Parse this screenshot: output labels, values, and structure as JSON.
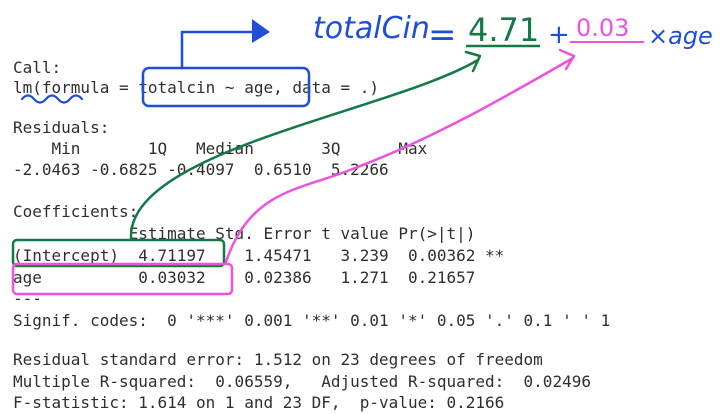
{
  "output": {
    "call_header": "Call:",
    "call_line": "lm(formula = totalcin ~ age, data = .)",
    "residuals_header": "Residuals:",
    "residuals_labels": "    Min       1Q   Median       3Q      Max ",
    "residuals_values": "-2.0463 -0.6825 -0.4097  0.6510  5.2266 ",
    "coef_header": "Coefficients:",
    "coef_columns": "            Estimate Std. Error t value Pr(>|t|)   ",
    "coef_intercept": "(Intercept)  4.71197    1.45471   3.239  0.00362 **",
    "coef_age": "age          0.03032    0.02386   1.271  0.21657   ",
    "separator": "---",
    "signif_codes": "Signif. codes:  0 '***' 0.001 '**' 0.01 '*' 0.05 '.' 0.1 ' ' 1",
    "rse": "Residual standard error: 1.512 on 23 degrees of freedom",
    "r_squared": "Multiple R-squared:  0.06559,\tAdjusted R-squared:  0.02496 ",
    "f_statistic": "F-statistic: 1.614 on 1 and 23 DF,  p-value: 0.2166"
  },
  "annotations": {
    "response": "totalCin",
    "equals": "=",
    "intercept_value": "4.71",
    "plus": "+",
    "slope_value": "0.03",
    "times_predictor": "×age",
    "colors": {
      "blue": "#1f4fd8",
      "green": "#137a45",
      "magenta": "#ee52df"
    }
  }
}
